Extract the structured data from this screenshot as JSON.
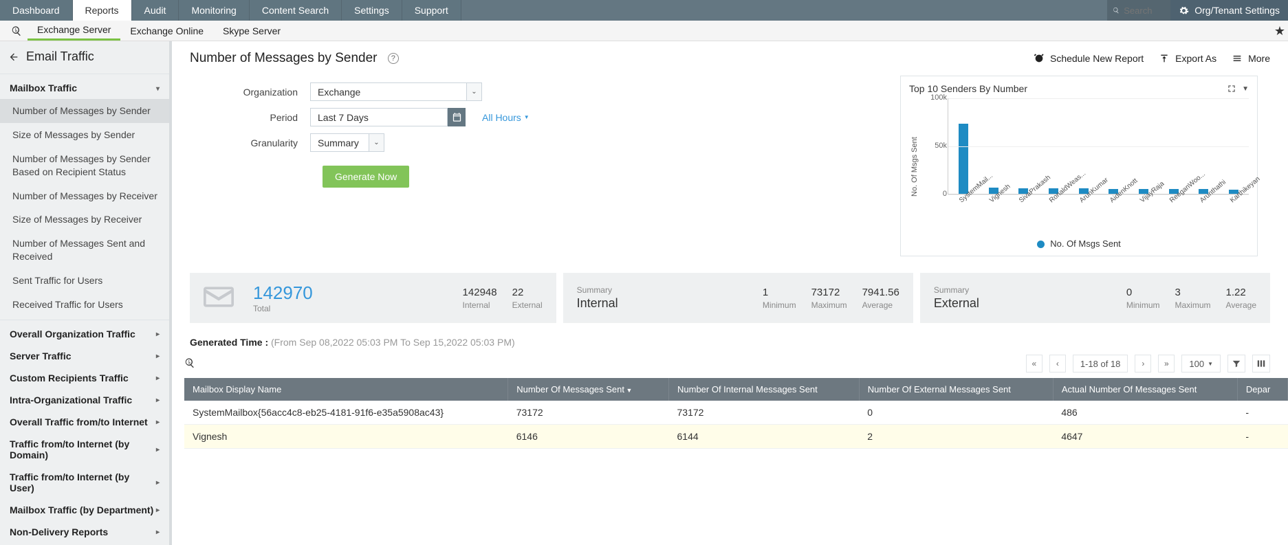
{
  "topnav": {
    "tabs": [
      "Dashboard",
      "Reports",
      "Audit",
      "Monitoring",
      "Content Search",
      "Settings",
      "Support"
    ],
    "active_index": 1,
    "search_placeholder": "Search",
    "org_settings": "Org/Tenant Settings"
  },
  "subnav": {
    "tabs": [
      "Exchange Server",
      "Exchange Online",
      "Skype Server"
    ],
    "active_index": 0
  },
  "sidebar": {
    "title": "Email Traffic",
    "sections": {
      "mailbox_traffic": {
        "label": "Mailbox Traffic",
        "expanded": true,
        "items": [
          "Number of Messages by Sender",
          "Size of Messages by Sender",
          "Number of Messages by Sender Based on Recipient Status",
          "Number of Messages by Receiver",
          "Size of Messages by Receiver",
          "Number of Messages Sent and Received",
          "Sent Traffic for Users",
          "Received Traffic for Users"
        ],
        "active_index": 0
      },
      "rest": [
        "Overall Organization Traffic",
        "Server Traffic",
        "Custom Recipients Traffic",
        "Intra-Organizational Traffic",
        "Overall Traffic from/to Internet",
        "Traffic from/to Internet (by Domain)",
        "Traffic from/to Internet (by User)",
        "Mailbox Traffic (by Department)",
        "Non-Delivery Reports"
      ]
    }
  },
  "page": {
    "title": "Number of Messages by Sender",
    "actions": {
      "schedule": "Schedule New Report",
      "export": "Export As",
      "more": "More"
    }
  },
  "form": {
    "org_label": "Organization",
    "org_value": "Exchange",
    "period_label": "Period",
    "period_value": "Last 7 Days",
    "hours": "All Hours",
    "gran_label": "Granularity",
    "gran_value": "Summary",
    "generate": "Generate Now"
  },
  "chart_title": "Top 10 Senders By Number",
  "chart_legend": "No. Of Msgs Sent",
  "chart_data": {
    "type": "bar",
    "title": "Top 10 Senders By Number",
    "ylabel": "No. Of Msgs Sent",
    "ylim": [
      0,
      100000
    ],
    "yticks": [
      {
        "v": 0,
        "label": "0"
      },
      {
        "v": 50000,
        "label": "50k"
      },
      {
        "v": 100000,
        "label": "100k"
      }
    ],
    "categories": [
      "SystemMail...",
      "Vignesh",
      "SivaPrakash",
      "RonaldWeas...",
      "ArunKumar",
      "AidenKnott",
      "VijayRaja",
      "ReeganWoo...",
      "Arunthathi",
      "Karthikeyan"
    ],
    "values": [
      73172,
      6146,
      6000,
      5800,
      5500,
      5300,
      5100,
      4900,
      4700,
      4500
    ],
    "series_name": "No. Of Msgs Sent"
  },
  "summary": {
    "total": {
      "value": "142970",
      "label": "Total"
    },
    "internal": {
      "value": "142948",
      "label": "Internal"
    },
    "external": {
      "value": "22",
      "label": "External"
    },
    "internal_card": {
      "title_small": "Summary",
      "title_big": "Internal",
      "min": "1",
      "max": "73172",
      "avg": "7941.56",
      "min_l": "Minimum",
      "max_l": "Maximum",
      "avg_l": "Average"
    },
    "external_card": {
      "title_small": "Summary",
      "title_big": "External",
      "min": "0",
      "max": "3",
      "avg": "1.22",
      "min_l": "Minimum",
      "max_l": "Maximum",
      "avg_l": "Average"
    }
  },
  "generated": {
    "label": "Generated Time : ",
    "range": "(From Sep 08,2022 05:03 PM To Sep 15,2022 05:03 PM)"
  },
  "toolbar": {
    "range": "1-18 of 18",
    "page_size": "100"
  },
  "table": {
    "cols": [
      "Mailbox Display Name",
      "Number Of Messages Sent",
      "Number Of Internal Messages Sent",
      "Number Of External Messages Sent",
      "Actual Number Of Messages Sent",
      "Depar"
    ],
    "sorted_col": 1,
    "rows": [
      {
        "name": "SystemMailbox{56acc4c8-eb25-4181-91f6-e35a5908ac43}",
        "sent": "73172",
        "int": "73172",
        "ext": "0",
        "actual": "486",
        "dept": "-"
      },
      {
        "name": "Vignesh",
        "sent": "6146",
        "int": "6144",
        "ext": "2",
        "actual": "4647",
        "dept": "-"
      }
    ]
  }
}
